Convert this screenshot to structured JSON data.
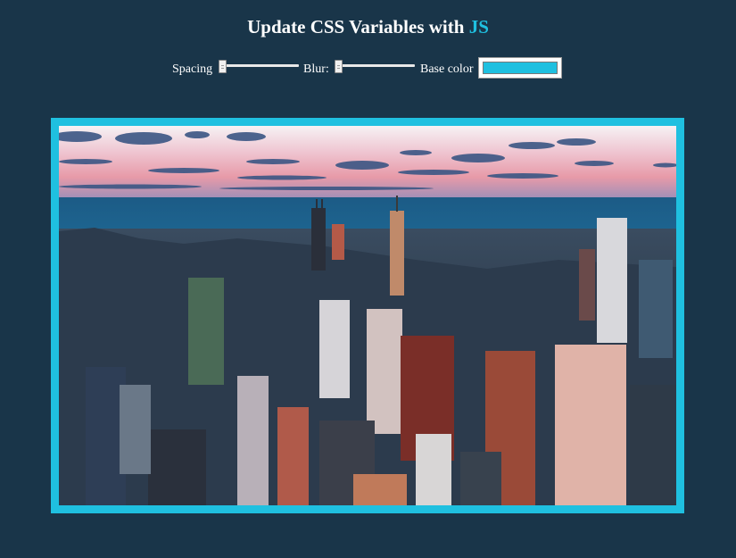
{
  "page": {
    "title_prefix": "Update CSS Variables with ",
    "title_highlight": "JS"
  },
  "controls": {
    "spacing_label": "Spacing",
    "spacing_value": 0,
    "blur_label": "Blur:",
    "blur_value": 0,
    "base_color_label": "Base color",
    "base_color_value": "#1fc0e0"
  },
  "image": {
    "alt": "Aerial view of a city skyline by the water at sunset",
    "frame_color": "#1fc0e0"
  },
  "colors": {
    "background": "#193549",
    "accent": "#1fc0e0",
    "text": "#ffffff"
  }
}
